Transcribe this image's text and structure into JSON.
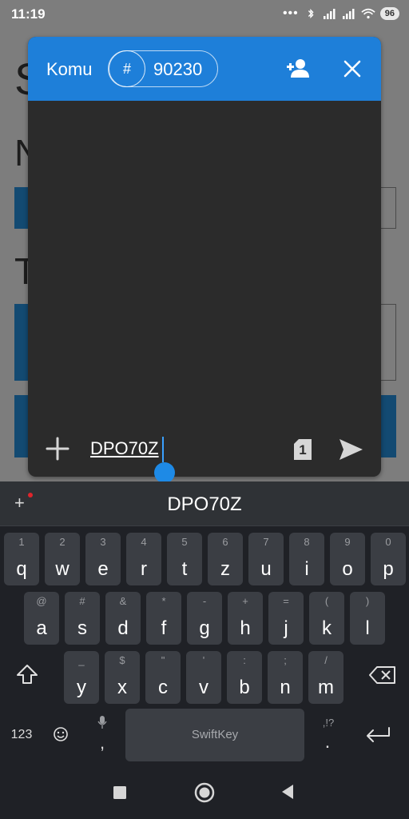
{
  "status": {
    "time": "11:19",
    "battery": "96"
  },
  "background": {
    "letter_s": "S",
    "letter_n": "N",
    "letter_t": "T"
  },
  "chat": {
    "title": "Komu",
    "room_hash": "#",
    "room_number": "90230",
    "input_value": "DPO70Z",
    "page_count": "1",
    "icons": {
      "add_user": "add-user-icon",
      "close": "close-icon",
      "plus": "plus-icon",
      "page": "page-icon",
      "send": "send-icon"
    }
  },
  "keyboard": {
    "suggestion": "DPO70Z",
    "row1": [
      {
        "hint": "1",
        "ch": "q"
      },
      {
        "hint": "2",
        "ch": "w"
      },
      {
        "hint": "3",
        "ch": "e"
      },
      {
        "hint": "4",
        "ch": "r"
      },
      {
        "hint": "5",
        "ch": "t"
      },
      {
        "hint": "6",
        "ch": "z"
      },
      {
        "hint": "7",
        "ch": "u"
      },
      {
        "hint": "8",
        "ch": "i"
      },
      {
        "hint": "9",
        "ch": "o"
      },
      {
        "hint": "0",
        "ch": "p"
      }
    ],
    "row2": [
      {
        "hint": "@",
        "ch": "a"
      },
      {
        "hint": "#",
        "ch": "s"
      },
      {
        "hint": "&",
        "ch": "d"
      },
      {
        "hint": "*",
        "ch": "f"
      },
      {
        "hint": "-",
        "ch": "g"
      },
      {
        "hint": "+",
        "ch": "h"
      },
      {
        "hint": "=",
        "ch": "j"
      },
      {
        "hint": "(",
        "ch": "k"
      },
      {
        "hint": ")",
        "ch": "l"
      }
    ],
    "row3": [
      {
        "hint": "_",
        "ch": "y"
      },
      {
        "hint": "$",
        "ch": "x"
      },
      {
        "hint": "\"",
        "ch": "c"
      },
      {
        "hint": "'",
        "ch": "v"
      },
      {
        "hint": ":",
        "ch": "b"
      },
      {
        "hint": ";",
        "ch": "n"
      },
      {
        "hint": "/",
        "ch": "m"
      }
    ],
    "numbers_label": "123",
    "comma": ",",
    "period": ".",
    "period_hint": ",!?",
    "space_brand": "SwiftKey"
  },
  "colors": {
    "header": "#1e7fd9",
    "chat_bg": "#2b2b2b",
    "keyboard_bg": "#1f2126",
    "key_bg": "#3b3e44"
  }
}
